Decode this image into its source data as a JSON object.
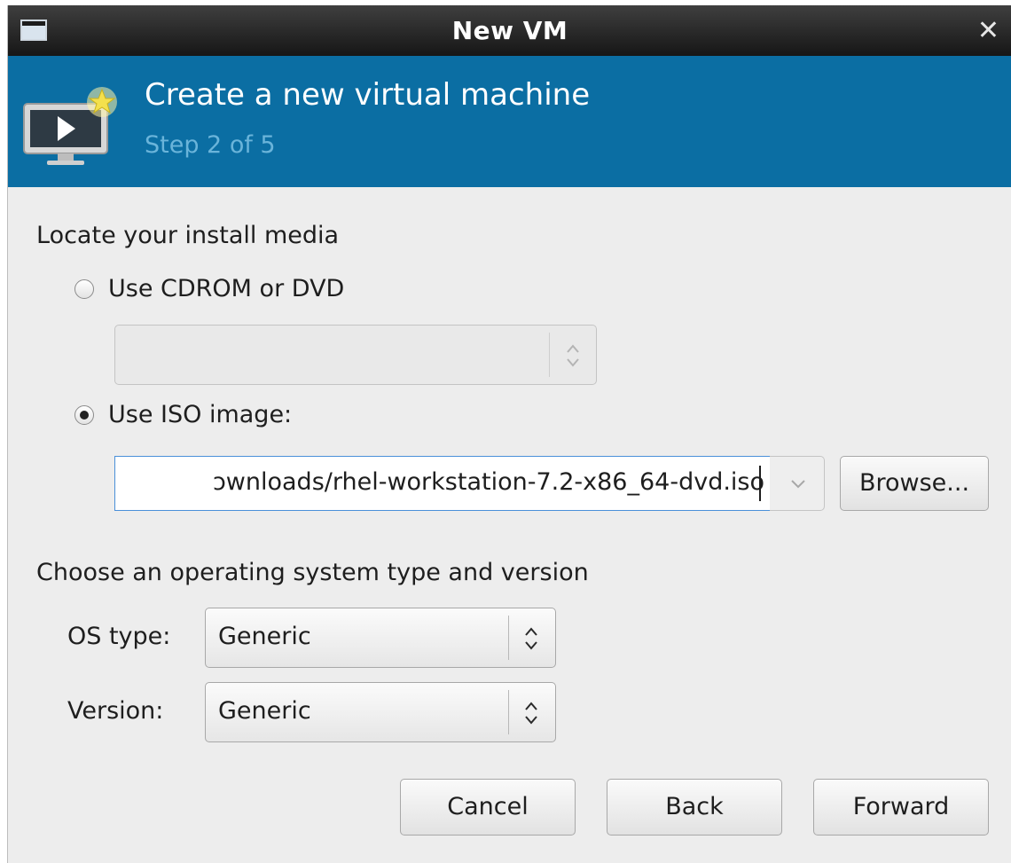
{
  "window": {
    "title": "New VM"
  },
  "banner": {
    "title": "Create a new virtual machine",
    "step": "Step 2 of 5"
  },
  "install_media": {
    "heading": "Locate your install media",
    "cdrom_label": "Use CDROM or DVD",
    "cdrom_selected": false,
    "cdrom_device_value": "",
    "iso_label": "Use ISO image:",
    "iso_selected": true,
    "iso_path_visible": "ɔwnloads/rhel-workstation-7.2-x86_64-dvd.iso",
    "browse_label": "Browse..."
  },
  "os": {
    "heading": "Choose an operating system type and version",
    "type_label": "OS type:",
    "type_value": "Generic",
    "version_label": "Version:",
    "version_value": "Generic"
  },
  "buttons": {
    "cancel": "Cancel",
    "back": "Back",
    "forward": "Forward"
  },
  "colors": {
    "banner": "#0b6ea3",
    "banner_subtitle": "#6ab4da",
    "titlebar": "#1e1e1e",
    "background": "#ededed",
    "focus_border": "#4a90d9"
  },
  "icons": {
    "window": "window-icon",
    "close": "close-icon",
    "vm": "virtual-machine-icon",
    "spin": "up-down-arrows-icon",
    "dropdown": "chevron-down-icon"
  }
}
